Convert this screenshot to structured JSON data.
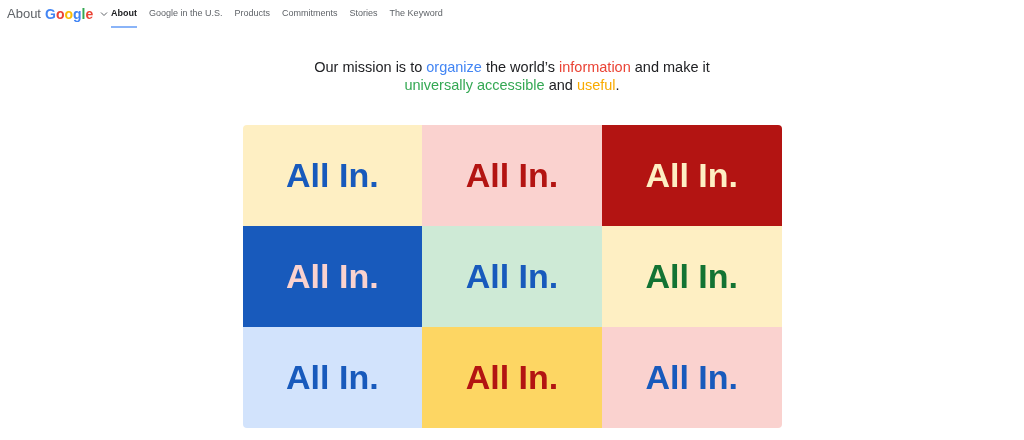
{
  "brand": {
    "label": "About",
    "logo_letters": [
      {
        "text": "G",
        "color": "#4285f4"
      },
      {
        "text": "o",
        "color": "#ea4335"
      },
      {
        "text": "o",
        "color": "#fbbc04"
      },
      {
        "text": "g",
        "color": "#4285f4"
      },
      {
        "text": "l",
        "color": "#34a853"
      },
      {
        "text": "e",
        "color": "#ea4335"
      }
    ]
  },
  "nav": [
    {
      "label": "About",
      "selected": true
    },
    {
      "label": "Google in the U.S.",
      "selected": false
    },
    {
      "label": "Products",
      "selected": false
    },
    {
      "label": "Commitments",
      "selected": false
    },
    {
      "label": "Stories",
      "selected": false
    },
    {
      "label": "The Keyword",
      "selected": false
    }
  ],
  "mission": [
    {
      "text": "Our mission is to "
    },
    {
      "text": "organize",
      "color": "#4285f4"
    },
    {
      "text": " the world’s "
    },
    {
      "text": "information",
      "color": "#ea4335"
    },
    {
      "text": " and make it "
    },
    {
      "text": "universally accessible",
      "color": "#34a853"
    },
    {
      "text": " and "
    },
    {
      "text": "useful",
      "color": "#f9ab00"
    },
    {
      "text": "."
    }
  ],
  "tiles": [
    {
      "color": "#feefc3",
      "slogan": {
        "text": "All In.",
        "color": "#185abc"
      }
    },
    {
      "color": "#fad2cf",
      "slogan": {
        "text": "All In.",
        "color": "#b31412"
      }
    },
    {
      "color": "#b31412",
      "slogan": {
        "text": "All In.",
        "color": "#feefc3"
      }
    },
    {
      "color": "#185abc",
      "slogan": {
        "text": "All In.",
        "color": "#fad2cf"
      }
    },
    {
      "color": "#ceead6",
      "slogan": {
        "text": "All In.",
        "color": "#185abc"
      }
    },
    {
      "color": "#feefc3",
      "slogan": {
        "text": "All In.",
        "color": "#137333"
      }
    },
    {
      "color": "#d2e3fc",
      "slogan": {
        "text": "All In.",
        "color": "#185abc"
      }
    },
    {
      "color": "#fdd663",
      "slogan": {
        "text": "All In.",
        "color": "#b31412"
      }
    },
    {
      "color": "#fad2cf",
      "slogan": {
        "text": "All In.",
        "color": "#185abc"
      }
    }
  ]
}
